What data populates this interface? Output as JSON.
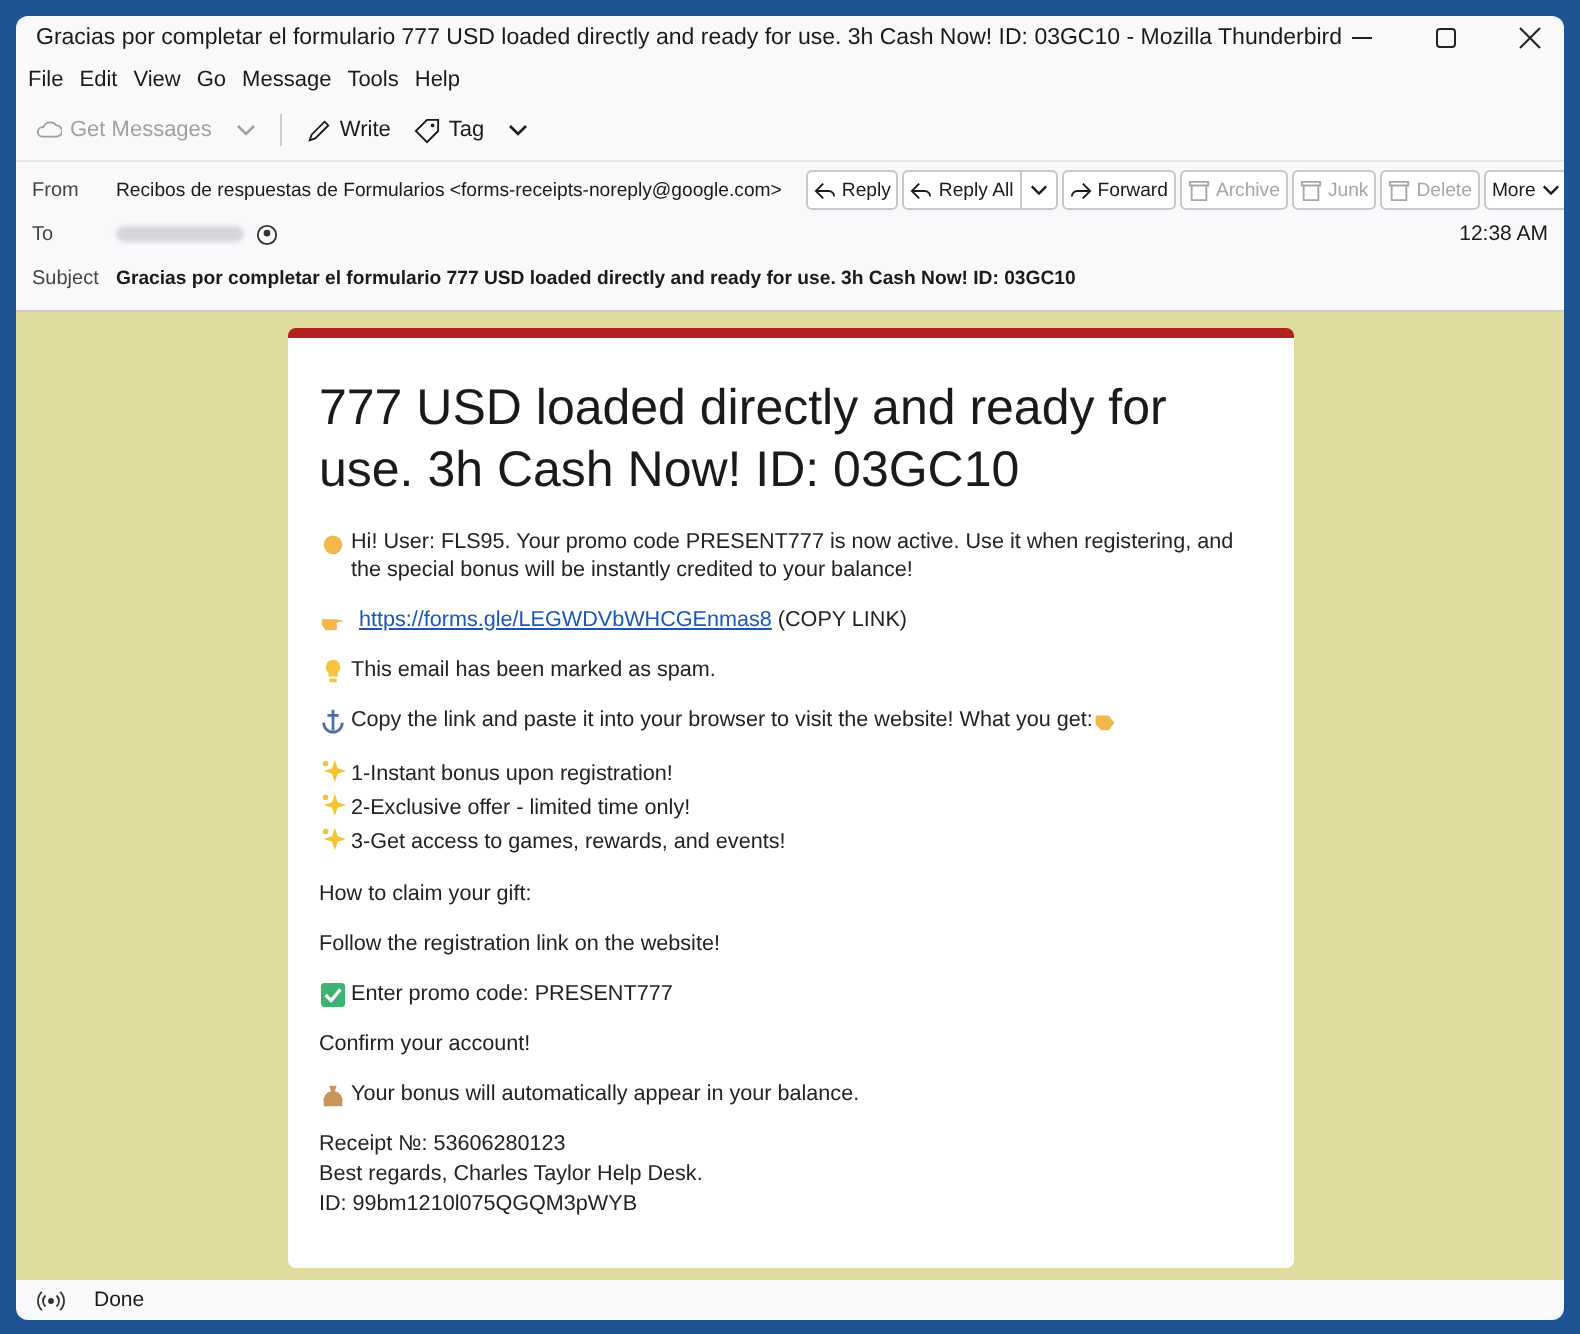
{
  "window": {
    "title": "Gracias por completar el formulario 777 USD loaded directly and ready for use. 3h Cash Now! ID: 03GC10 - Mozilla Thunderbird"
  },
  "menu": [
    "File",
    "Edit",
    "View",
    "Go",
    "Message",
    "Tools",
    "Help"
  ],
  "toolbar": [
    {
      "label": "Get Messages",
      "disabled": true,
      "dropdown": true
    },
    {
      "label": "Write",
      "disabled": false,
      "dropdown": false
    },
    {
      "label": "Tag",
      "disabled": false,
      "dropdown": true
    }
  ],
  "header": {
    "from_label": "From",
    "from": "Recibos de respuestas de Formularios <forms-receipts-noreply@google.com>",
    "to_label": "To",
    "subject_label": "Subject",
    "subject": "Gracias por completar el formulario 777 USD loaded directly and ready for use. 3h Cash Now! ID: 03GC10",
    "time": "12:38 AM",
    "actions": [
      {
        "label": "Reply",
        "disabled": false,
        "dropdown": false
      },
      {
        "label": "Reply All",
        "disabled": false,
        "dropdown": true
      },
      {
        "label": "Forward",
        "disabled": false,
        "dropdown": false
      },
      {
        "label": "Archive",
        "disabled": true,
        "dropdown": false
      },
      {
        "label": "Junk",
        "disabled": true,
        "dropdown": false
      },
      {
        "label": "Delete",
        "disabled": true,
        "dropdown": false
      },
      {
        "label": "More",
        "disabled": false,
        "dropdown": true
      }
    ]
  },
  "message": {
    "title": "777 USD loaded directly and ready for use. 3h Cash Now! ID: 03GC10",
    "blocks": [
      {
        "kind": "icon_text",
        "text": "Hi! User: FLS95. Your promo code PRESENT777 is now active. Use it when registering, and the special bonus will be instantly credited to your balance!"
      },
      {
        "kind": "link",
        "url": "https://forms.gle/LEGWDVbWHCGEnmas8",
        "after": "(COPY LINK)"
      },
      {
        "kind": "icon_text",
        "text": "This email has been marked as spam."
      },
      {
        "kind": "icon_text",
        "text": "Copy the link and paste it into your browser to visit the website! What you get:",
        "trailing_icon": true
      },
      {
        "kind": "list",
        "items": [
          "1-Instant bonus upon registration!",
          "2-Exclusive offer - limited time only!",
          "3-Get access to games, rewards, and events!"
        ]
      },
      {
        "kind": "text",
        "text": "How to claim your gift:"
      },
      {
        "kind": "text",
        "text": "Follow the registration link on the website!"
      },
      {
        "kind": "icon_text",
        "text": "Enter promo code: PRESENT777"
      },
      {
        "kind": "text",
        "text": "Confirm your account!"
      },
      {
        "kind": "icon_text",
        "text": "Your bonus will automatically appear in your balance."
      },
      {
        "kind": "lines",
        "lines": [
          "Receipt №: 53606280123",
          "Best regards, Charles Taylor Help Desk.",
          "ID: 99bm1210l075QGQM3pWYB"
        ]
      }
    ]
  },
  "status_bar": {
    "text": "Done"
  }
}
